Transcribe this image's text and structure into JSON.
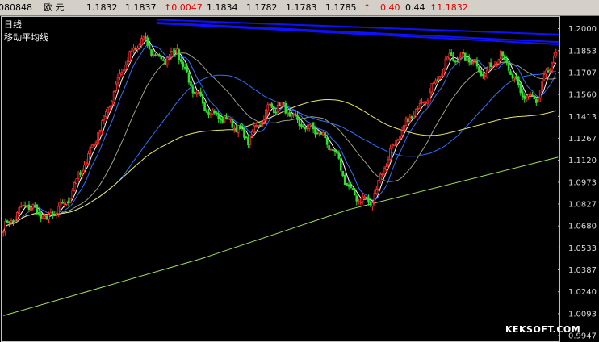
{
  "toolbar": {
    "code": "080848",
    "name": "欧  元",
    "open": "1.1832",
    "high": "1.1837",
    "change": "↑0.0047",
    "last": "1.1834",
    "low": "1.1782",
    "prev_close": "1.1783",
    "bid": "1.1785",
    "arrow": "↑",
    "change_pct": "0.40",
    "amplitude": "0.44",
    "close_marker": "↑1.1832"
  },
  "legend": {
    "period": "日线",
    "indicator": "移动平均线"
  },
  "watermark": "KEKSOFT.COM",
  "colors": {
    "up": "#ff3030",
    "down": "#30e030",
    "ma_short": "#ffffff",
    "ma_mid": "#3070ff",
    "ma_mid2": "#a0a080",
    "ma_long": "#e8e860",
    "ma_longest": "#a0e060",
    "trendline": "#1010ff",
    "frame": "#c0c0c0"
  },
  "chart_data": {
    "type": "candlestick",
    "instrument": "欧元",
    "yticks": [
      "1.2000",
      "1.1853",
      "1.1707",
      "1.1560",
      "1.1413",
      "1.1267",
      "1.1120",
      "1.0973",
      "1.0827",
      "1.0680",
      "1.0533",
      "1.0387",
      "1.0240",
      "1.0093",
      "0.9947"
    ],
    "ylim": [
      0.9947,
      1.2073
    ],
    "anchors": [
      [
        0,
        1.066
      ],
      [
        12,
        1.083
      ],
      [
        22,
        1.072
      ],
      [
        32,
        1.084
      ],
      [
        42,
        1.112
      ],
      [
        52,
        1.143
      ],
      [
        60,
        1.173
      ],
      [
        70,
        1.193
      ],
      [
        80,
        1.178
      ],
      [
        88,
        1.186
      ],
      [
        96,
        1.158
      ],
      [
        106,
        1.143
      ],
      [
        116,
        1.137
      ],
      [
        124,
        1.126
      ],
      [
        134,
        1.146
      ],
      [
        140,
        1.149
      ],
      [
        150,
        1.136
      ],
      [
        160,
        1.131
      ],
      [
        168,
        1.116
      ],
      [
        176,
        1.09
      ],
      [
        186,
        1.083
      ],
      [
        196,
        1.118
      ],
      [
        206,
        1.14
      ],
      [
        216,
        1.158
      ],
      [
        226,
        1.181
      ],
      [
        236,
        1.18
      ],
      [
        244,
        1.169
      ],
      [
        252,
        1.184
      ],
      [
        262,
        1.157
      ],
      [
        270,
        1.152
      ],
      [
        276,
        1.172
      ],
      [
        280,
        1.183
      ]
    ],
    "n_bars": 281,
    "moving_averages": [
      {
        "period": 5,
        "color": "#ffffff"
      },
      {
        "period": 10,
        "color": "#3070ff"
      },
      {
        "period": 30,
        "color": "#a0a080"
      },
      {
        "period": 60,
        "color": "#3070ff"
      },
      {
        "period": 120,
        "color": "#e8e860"
      }
    ],
    "long_ma_line": [
      [
        0,
        1.008
      ],
      [
        100,
        1.046
      ],
      [
        175,
        1.079
      ],
      [
        281,
        1.114
      ]
    ],
    "trendlines": [
      [
        [
          78,
          1.206
        ],
        [
          281,
          1.196
        ]
      ],
      [
        [
          78,
          1.204
        ],
        [
          281,
          1.191
        ]
      ],
      [
        [
          78,
          1.2035
        ],
        [
          281,
          1.1895
        ]
      ]
    ]
  }
}
